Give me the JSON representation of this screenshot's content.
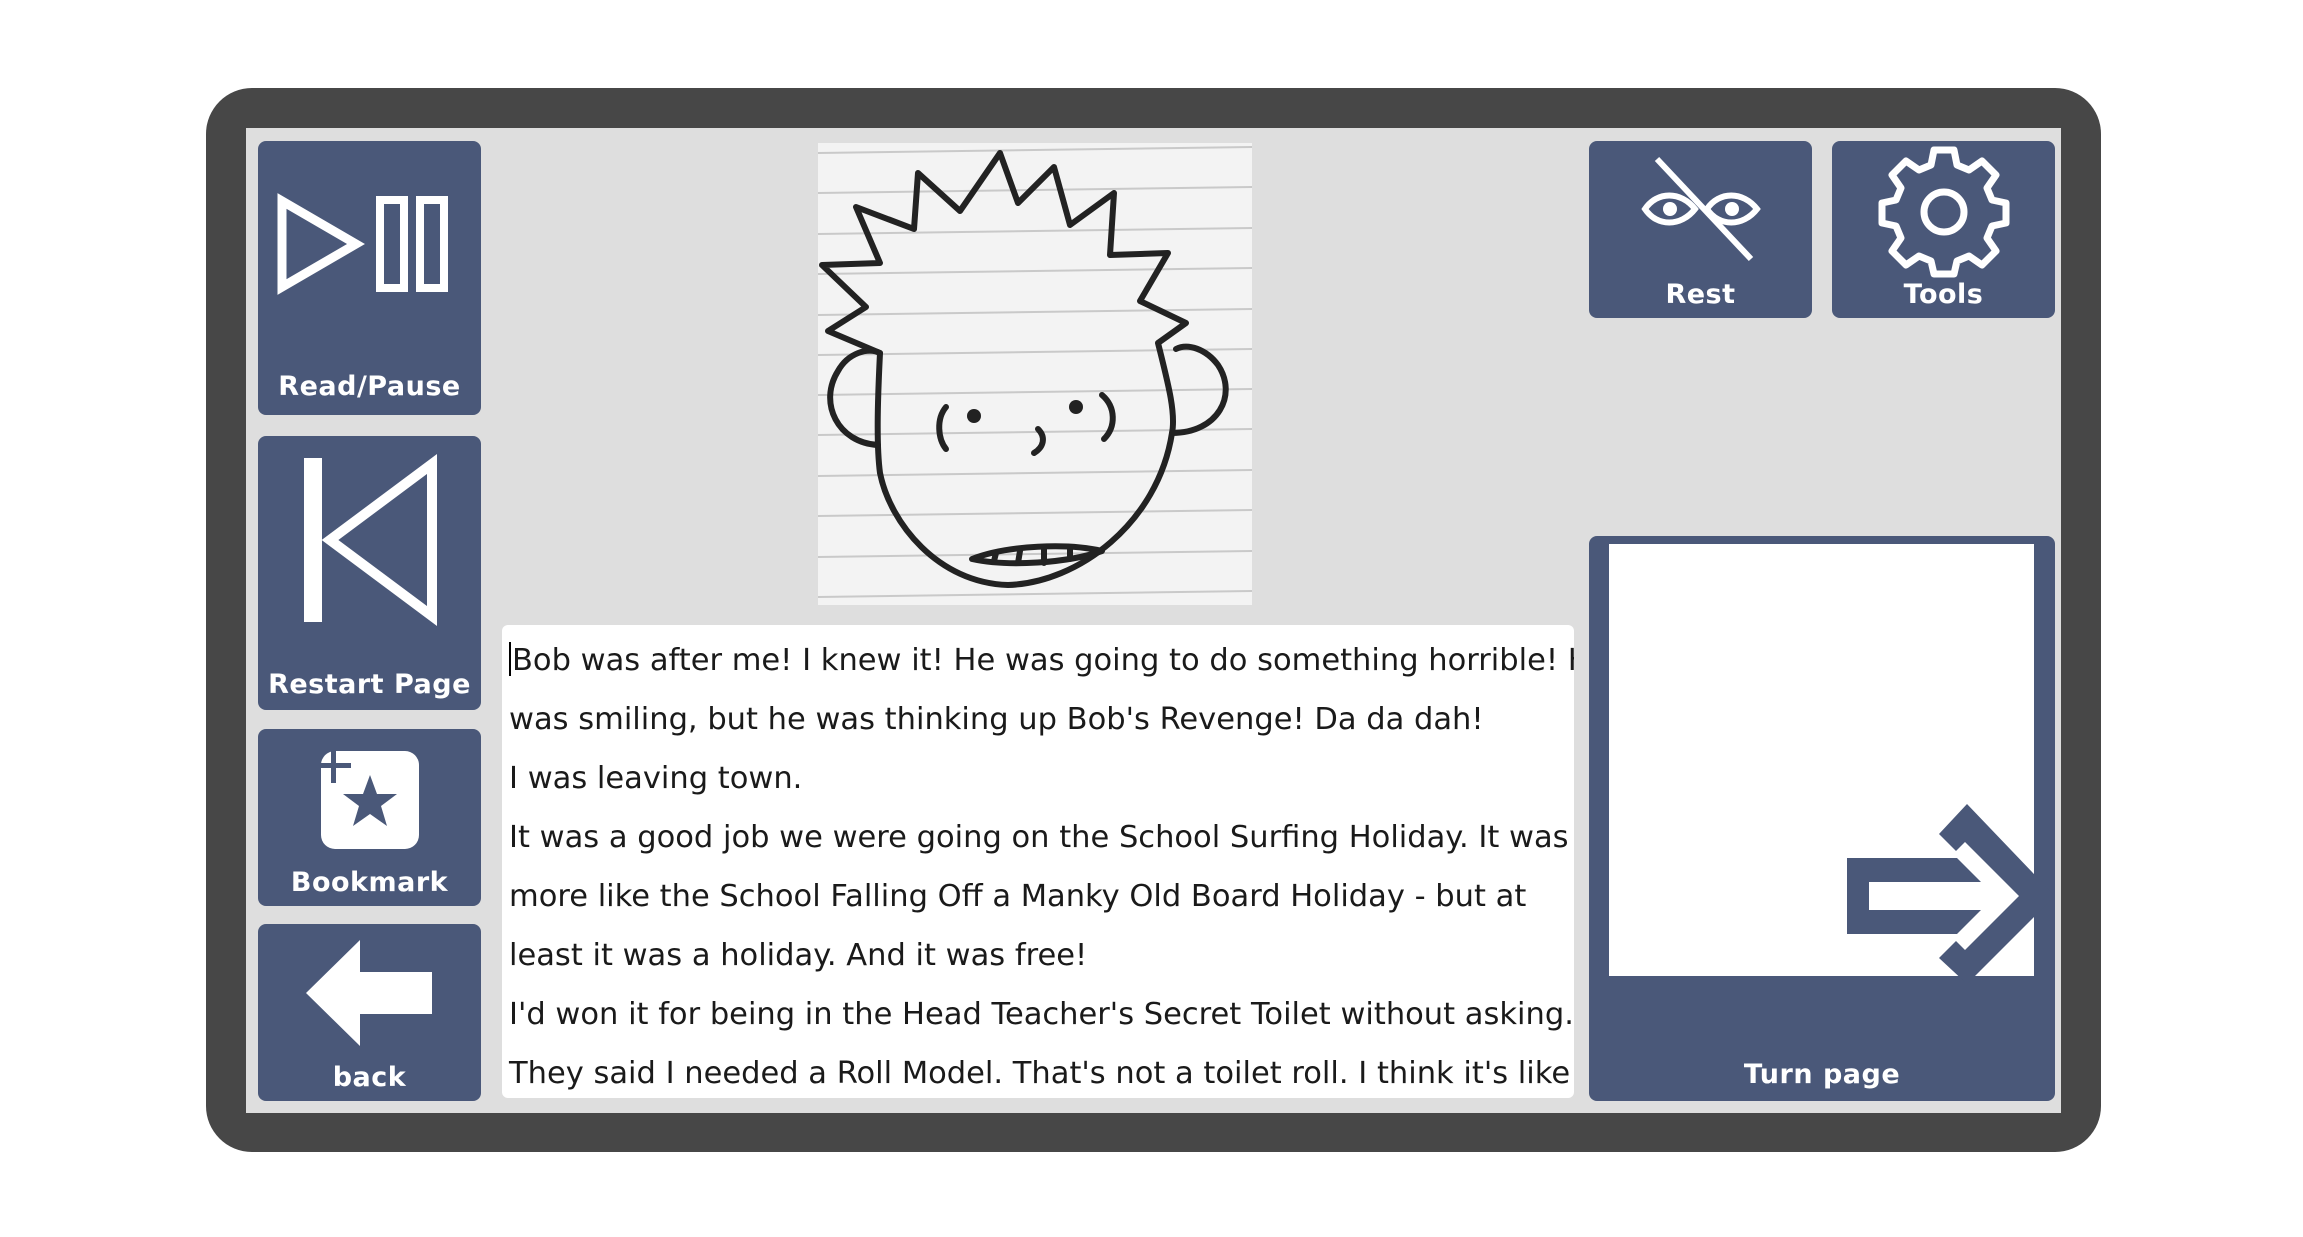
{
  "buttons": {
    "read_pause": "Read/Pause",
    "restart_page": "Restart Page",
    "bookmark": "Bookmark",
    "back": "back",
    "rest": "Rest",
    "tools": "Tools",
    "turn_page": "Turn page"
  },
  "story": {
    "lines": [
      "Bob was after me! I knew it! He was going to do something horrible! He",
      "was smiling, but he was thinking up Bob's Revenge! Da da dah!",
      "I was leaving town.",
      "It was a good job we were going on the School Surfing Holiday. It was",
      "more like the School Falling Off a Manky Old Board Holiday - but at",
      "least it was a holiday. And it was free!",
      "I'd won it for being in the Head Teacher's Secret Toilet without asking.",
      "They said I needed a Roll Model. That's not a toilet roll. I think it's like a"
    ]
  },
  "colors": {
    "tile": "#4a5879",
    "frame": "#474747",
    "screen": "#dedede"
  },
  "icons": {
    "read_pause": "play-pause-icon",
    "restart": "skip-back-icon",
    "bookmark": "bookmark-star-icon",
    "back": "arrow-left-icon",
    "rest": "eyes-crossed-icon",
    "tools": "gear-icon",
    "turn": "arrow-right-icon"
  }
}
